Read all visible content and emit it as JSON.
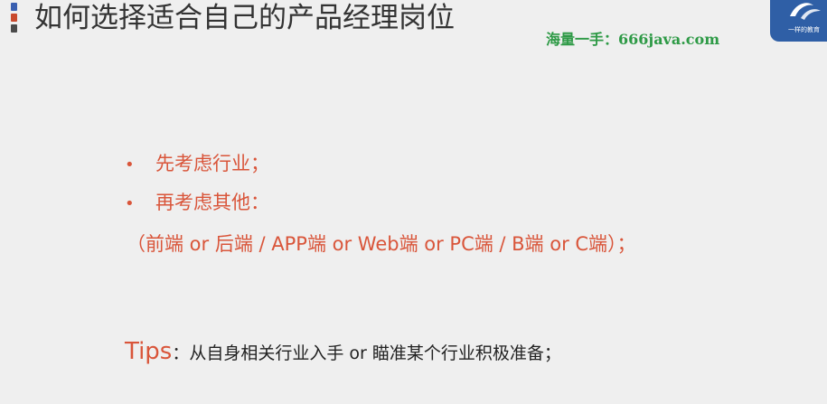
{
  "slide": {
    "title": "如何选择适合自己的产品经理岗位",
    "watermark": "海量一手：666java.com",
    "logo_caption": "一样的教育"
  },
  "content": {
    "bullets": [
      {
        "marker": "•",
        "text": "先考虑行业；"
      },
      {
        "marker": "•",
        "text": "再考虑其他："
      }
    ],
    "detail": "（前端 or 后端 / APP端 or Web端 or PC端 / B端 or C端）；",
    "tips_label": "Tips",
    "tips_text": "：从自身相关行业入手 or 瞄准某个行业积极准备；"
  },
  "colors": {
    "accent": "#d9553a",
    "title": "#333333",
    "watermark": "#2e9a46",
    "logo_bg": "#2f5fa6",
    "background": "#efefef"
  }
}
